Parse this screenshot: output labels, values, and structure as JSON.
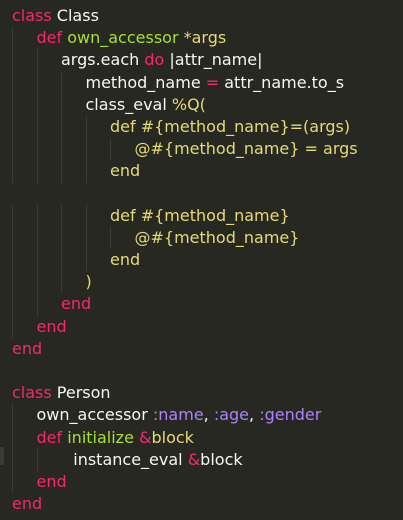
{
  "editor": {
    "theme_colors": {
      "background": "#272822",
      "keyword": "#f92672",
      "function": "#a6e22e",
      "string": "#e6db74",
      "symbol": "#ae81ff",
      "text": "#f8f8f2"
    },
    "lines": [
      {
        "indent": 0,
        "tokens": [
          {
            "t": "class",
            "c": "kw"
          },
          {
            "t": " Class",
            "c": "plain"
          }
        ]
      },
      {
        "indent": 1,
        "tokens": [
          {
            "t": "def",
            "c": "kw"
          },
          {
            "t": " own_accessor ",
            "c": "fn"
          },
          {
            "t": "*args",
            "c": "str"
          }
        ]
      },
      {
        "indent": 2,
        "tokens": [
          {
            "t": "args.each ",
            "c": "plain"
          },
          {
            "t": "do",
            "c": "kw"
          },
          {
            "t": " |attr_name|",
            "c": "plain"
          }
        ]
      },
      {
        "indent": 3,
        "tokens": [
          {
            "t": "method_name ",
            "c": "plain"
          },
          {
            "t": "=",
            "c": "kw"
          },
          {
            "t": " attr_name.to_s",
            "c": "plain"
          }
        ]
      },
      {
        "indent": 3,
        "tokens": [
          {
            "t": "class_eval ",
            "c": "plain"
          },
          {
            "t": "%Q(",
            "c": "str"
          }
        ]
      },
      {
        "indent": 4,
        "tokens": [
          {
            "t": "def #{method_name}=(args)",
            "c": "str"
          }
        ]
      },
      {
        "indent": 5,
        "tokens": [
          {
            "t": "@#{method_name} = args",
            "c": "str"
          }
        ]
      },
      {
        "indent": 4,
        "tokens": [
          {
            "t": "end",
            "c": "str"
          }
        ]
      },
      {
        "indent": 0,
        "tokens": []
      },
      {
        "indent": 4,
        "tokens": [
          {
            "t": "def #{method_name}",
            "c": "str"
          }
        ]
      },
      {
        "indent": 5,
        "tokens": [
          {
            "t": "@#{method_name}",
            "c": "str"
          }
        ]
      },
      {
        "indent": 4,
        "tokens": [
          {
            "t": "end",
            "c": "str"
          }
        ]
      },
      {
        "indent": 3,
        "tokens": [
          {
            "t": ")",
            "c": "str"
          }
        ]
      },
      {
        "indent": 2,
        "tokens": [
          {
            "t": "end",
            "c": "kw"
          }
        ]
      },
      {
        "indent": 1,
        "tokens": [
          {
            "t": "end",
            "c": "kw"
          }
        ]
      },
      {
        "indent": 0,
        "tokens": [
          {
            "t": "end",
            "c": "kw"
          }
        ]
      },
      {
        "indent": 0,
        "tokens": []
      },
      {
        "indent": 0,
        "tokens": [
          {
            "t": "class",
            "c": "kw"
          },
          {
            "t": " Person",
            "c": "plain"
          }
        ]
      },
      {
        "indent": 1,
        "tokens": [
          {
            "t": "own_accessor ",
            "c": "plain"
          },
          {
            "t": ":name",
            "c": "sym"
          },
          {
            "t": ", ",
            "c": "plain"
          },
          {
            "t": ":age",
            "c": "sym"
          },
          {
            "t": ", ",
            "c": "plain"
          },
          {
            "t": ":gender",
            "c": "sym"
          }
        ]
      },
      {
        "indent": 1,
        "tokens": [
          {
            "t": "def",
            "c": "kw"
          },
          {
            "t": " initialize ",
            "c": "fn"
          },
          {
            "t": "&",
            "c": "kw"
          },
          {
            "t": "block",
            "c": "str"
          }
        ]
      },
      {
        "indent": 2.5,
        "tokens": [
          {
            "t": "instance_eval ",
            "c": "plain"
          },
          {
            "t": "&",
            "c": "kw"
          },
          {
            "t": "block",
            "c": "plain"
          }
        ]
      },
      {
        "indent": 1,
        "tokens": [
          {
            "t": "end",
            "c": "kw"
          }
        ]
      },
      {
        "indent": 0,
        "tokens": [
          {
            "t": "end",
            "c": "kw"
          }
        ]
      }
    ]
  }
}
